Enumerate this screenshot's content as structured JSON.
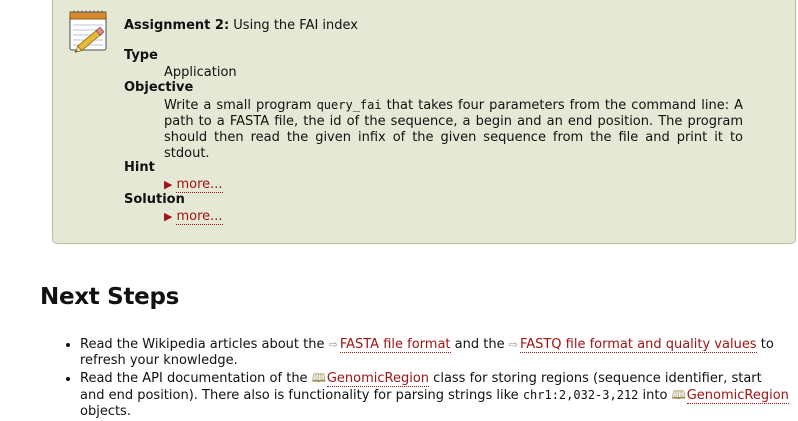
{
  "assignment": {
    "number_label": "Assignment 2:",
    "title": "Using the FAI index",
    "type_label": "Type",
    "type_value": "Application",
    "objective_label": "Objective",
    "objective_pre": "Write a small program ",
    "objective_code": "query_fai",
    "objective_post": " that takes four parameters from the command line: A path to a FASTA file, the id of the sequence, a begin and an end position. The program should then read the given infix of the given sequence from the file and print it to stdout.",
    "hint_label": "Hint",
    "hint_more": "more...",
    "solution_label": "Solution",
    "solution_more": "more..."
  },
  "next_steps": {
    "heading": "Next Steps",
    "item1": {
      "pre": "Read the Wikipedia articles about the ",
      "link1": "FASTA file format",
      "mid": " and the ",
      "link2": "FASTQ file format and quality values",
      "post": " to refresh your knowledge."
    },
    "item2": {
      "pre": "Read the API documentation of the ",
      "link1": "GenomicRegion",
      "mid": " class for storing regions (sequence identifier, start and end position). There also is functionality for parsing strings like ",
      "code": "chr1:2,032-3,212",
      "mid2": " into ",
      "link2": "GenomicRegion",
      "post": " objects."
    }
  },
  "colors": {
    "box_bg": "#e5e8d5",
    "link": "#a01414"
  }
}
